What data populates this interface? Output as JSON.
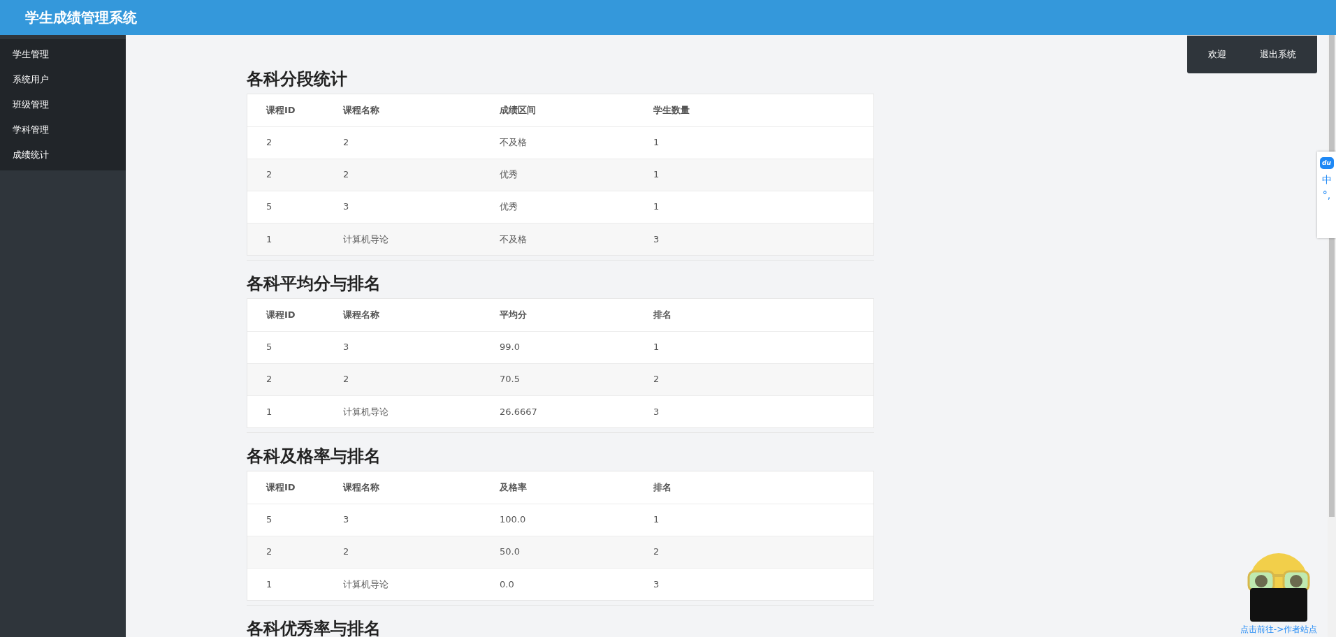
{
  "header": {
    "title": "学生成绩管理系统"
  },
  "sidebar": {
    "items": [
      {
        "label": "学生管理"
      },
      {
        "label": "系统用户"
      },
      {
        "label": "班级管理"
      },
      {
        "label": "学科管理"
      },
      {
        "label": "成绩统计"
      }
    ]
  },
  "user_menu": {
    "items": [
      {
        "label": "欢迎"
      },
      {
        "label": "退出系统"
      }
    ]
  },
  "sections": [
    {
      "title": "各科分段统计",
      "columns": [
        "课程ID",
        "课程名称",
        "成绩区间",
        "学生数量"
      ],
      "rows": [
        [
          "2",
          "2",
          "不及格",
          "1"
        ],
        [
          "2",
          "2",
          "优秀",
          "1"
        ],
        [
          "5",
          "3",
          "优秀",
          "1"
        ],
        [
          "1",
          "计算机导论",
          "不及格",
          "3"
        ]
      ]
    },
    {
      "title": "各科平均分与排名",
      "columns": [
        "课程ID",
        "课程名称",
        "平均分",
        "排名"
      ],
      "rows": [
        [
          "5",
          "3",
          "99.0",
          "1"
        ],
        [
          "2",
          "2",
          "70.5",
          "2"
        ],
        [
          "1",
          "计算机导论",
          "26.6667",
          "3"
        ]
      ]
    },
    {
      "title": "各科及格率与排名",
      "columns": [
        "课程ID",
        "课程名称",
        "及格率",
        "排名"
      ],
      "rows": [
        [
          "5",
          "3",
          "100.0",
          "1"
        ],
        [
          "2",
          "2",
          "50.0",
          "2"
        ],
        [
          "1",
          "计算机导论",
          "0.0",
          "3"
        ]
      ]
    },
    {
      "title": "各科优秀率与排名"
    }
  ],
  "ime_bar": {
    "logo": "du",
    "items": [
      "中",
      "°,"
    ]
  },
  "mascot": {
    "link": "点击前往->作者站点"
  }
}
